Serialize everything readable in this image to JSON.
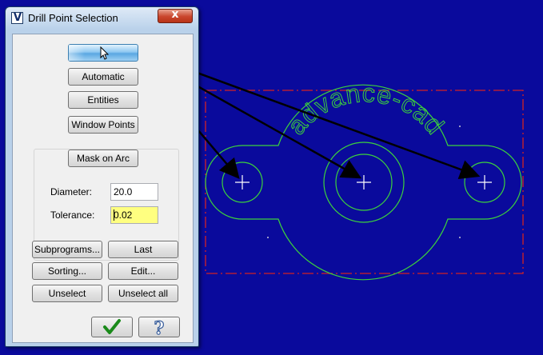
{
  "dialog": {
    "title": "Drill Point Selection",
    "app_icon_glyph": "V",
    "close_glyph": "x",
    "pick_button_icon": "cursor-arrow-icon",
    "buttons": {
      "automatic": "Automatic",
      "entities": "Entities",
      "window_points": "Window Points",
      "mask_on_arc": "Mask on Arc",
      "subprograms": "Subprograms...",
      "last": "Last",
      "sorting": "Sorting...",
      "edit": "Edit...",
      "unselect": "Unselect",
      "unselect_all": "Unselect all",
      "ok_icon": "checkmark-icon",
      "help_icon": "question-mark-icon"
    },
    "fields": {
      "diameter_label": "Diameter:",
      "diameter_value": "20.0",
      "tolerance_label": "Tolerance:",
      "tolerance_value": "0.02"
    }
  },
  "drawing": {
    "text": "advance-cad",
    "colors": {
      "background": "#0a0a9c",
      "geometry": "#3cd23c",
      "border": "#d22222",
      "markers": "#ffffff",
      "leaders": "#000000"
    }
  }
}
